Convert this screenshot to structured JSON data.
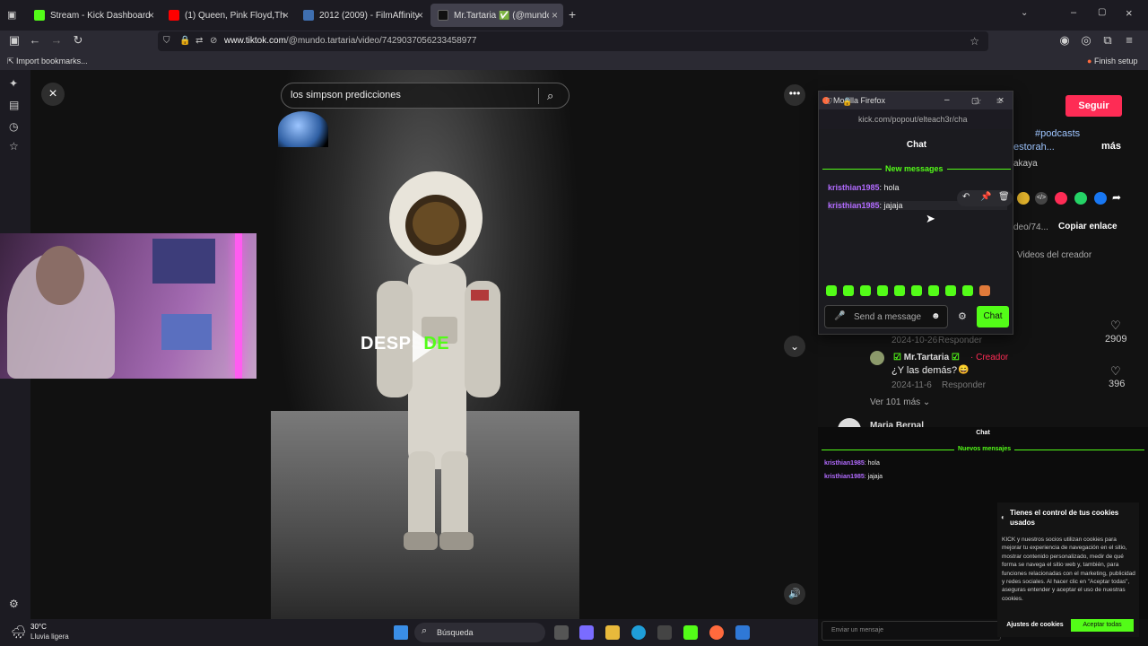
{
  "browser": {
    "tabs": [
      {
        "label": "Stream - Kick Dashboard",
        "color": "#53fc18"
      },
      {
        "label": "(1) Queen, Pink Floyd,The Who...",
        "color": "#ff0000"
      },
      {
        "label": "2012 (2009) - FilmAffinity",
        "color": "#3f6fb0"
      },
      {
        "label": "Mr.Tartaria ✅ (@mundo.ta...",
        "color": "#111111"
      }
    ],
    "url_domain": "www.tiktok.com",
    "url_path": "/@mundo.tartaria/video/7429037056233458977",
    "bookmarks": "Import bookmarks...",
    "finish_setup": "Finish setup"
  },
  "video": {
    "search_text": "los simpson predicciones",
    "overlay_white": "DESP",
    "overlay_green": "DE",
    "overlay_mid": "S"
  },
  "tiktok": {
    "follow": "Seguir",
    "hashtag": "#podcasts",
    "partial1": "estorah...",
    "more": "más",
    "partial2": "akaya",
    "copy_link": "Copiar enlace",
    "link_partial": "deo/74...",
    "creator_videos": "Videos del creador",
    "c1_date": "2024-10-26",
    "c1_reply": "Responder",
    "c1_likes": "2909",
    "c2_user": "Mr.Tartaria",
    "c2_badge": "· Creador",
    "c2_text": "¿Y las demás?",
    "c2_date": "2024-11-6",
    "c2_reply": "Responder",
    "c2_likes": "396",
    "more_replies": "Ver 101 más",
    "c3_user": "Maria Bernal"
  },
  "popup": {
    "title": "Mozilla Firefox",
    "url": "kick.com/popout/elteach3r/cha",
    "header": "Chat",
    "new_messages": "New messages",
    "messages": [
      {
        "user": "kristhian1985",
        "text": ": hola"
      },
      {
        "user": "kristhian1985",
        "text": ": jajaja"
      }
    ],
    "input_placeholder": "Send a message",
    "send": "Chat"
  },
  "kick_chat": {
    "header": "Chat",
    "new_messages": "Nuevos mensajes",
    "messages": [
      {
        "user": "kristhian1985",
        "text": ": hola"
      },
      {
        "user": "kristhian1985",
        "text": ": jajaja"
      }
    ],
    "input_placeholder": "Enviar un mensaje"
  },
  "cookies": {
    "title": "Tienes el control de tus cookies usados",
    "body": "KICK y nuestros socios utilizan cookies para mejorar tu experiencia de navegación en el sitio, mostrar contenido personalizado, medir de qué forma se navega el sitio web y, también, para funciones relacionadas con el marketing, publicidad y redes sociales. Al hacer clic en \"Aceptar todas\", aseguras entender y aceptar el uso de nuestras cookies.",
    "settings": "Ajustes de cookies",
    "accept": "Aceptar todas"
  },
  "taskbar": {
    "weather_temp": "30°C",
    "weather_desc": "Lluvia ligera",
    "search": "Búsqueda"
  },
  "colors": {
    "kick_green": "#53fc18",
    "tiktok_red": "#fe2c55",
    "username_purple": "#b26bff"
  }
}
